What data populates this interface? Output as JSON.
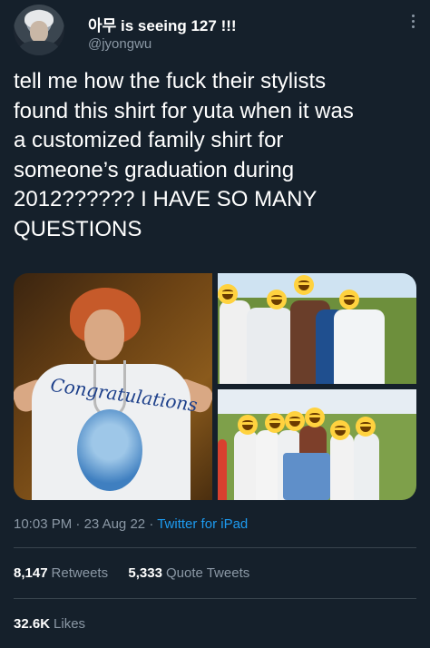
{
  "tweet": {
    "display_name": "아무 is seeing 127 !!!",
    "handle": "@jyongwu",
    "text": "tell me how the fuck their stylists\nfound this shirt for yuta when it was\na customized family shirt for\nsomeone’s graduation during\n2012?????? I HAVE SO MANY\nQUESTIONS",
    "time": "10:03 PM",
    "date": "23 Aug 22",
    "source": "Twitter for iPad",
    "retweets_count": "8,147",
    "retweets_label": "Retweets",
    "quotes_count": "5,333",
    "quotes_label": "Quote Tweets",
    "likes_count": "32.6K",
    "likes_label": "Likes"
  },
  "colors": {
    "background": "#15202b",
    "link": "#1d9bf0",
    "secondary_text": "#8b98a5",
    "divider": "#38444d"
  },
  "icons": [
    "avatar",
    "more-options-icon",
    "smile-emoji"
  ]
}
